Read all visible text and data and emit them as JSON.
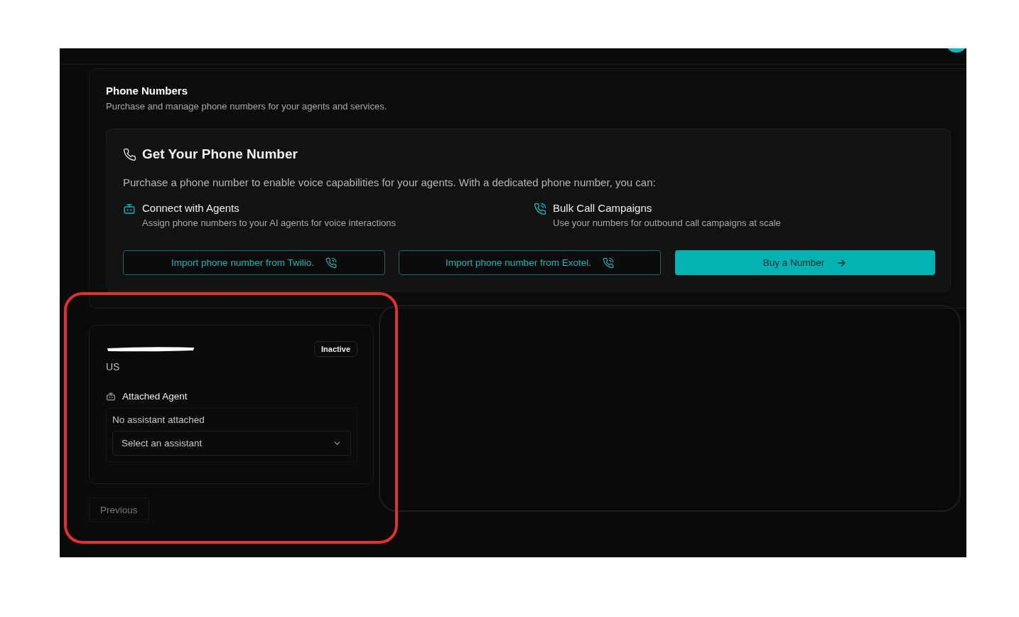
{
  "section": {
    "title": "Phone Numbers",
    "subtitle": "Purchase and manage phone numbers for your agents and services."
  },
  "promo": {
    "title": "Get Your Phone Number",
    "description": "Purchase a phone number to enable voice capabilities for your agents. With a dedicated phone number, you can:",
    "features": [
      {
        "kind": "agent",
        "title": "Connect with Agents",
        "text": "Assign phone numbers to your AI agents for voice interactions"
      },
      {
        "kind": "call",
        "title": "Bulk Call Campaigns",
        "text": "Use your numbers for outbound call campaigns at scale"
      }
    ],
    "buttons": [
      {
        "kind": "outline",
        "label": "Import phone number from Twilio."
      },
      {
        "kind": "outline",
        "label": "Import phone number from Exotel."
      },
      {
        "kind": "primary",
        "label": "Buy a Number"
      }
    ]
  },
  "number_card": {
    "country": "US",
    "status": "Inactive",
    "agent_label": "Attached Agent",
    "agent_value": "No assistant attached",
    "select": {
      "placeholder": "Select an assistant"
    }
  },
  "pagination": {
    "previous": {
      "label": "Previous",
      "disabled": true
    }
  }
}
